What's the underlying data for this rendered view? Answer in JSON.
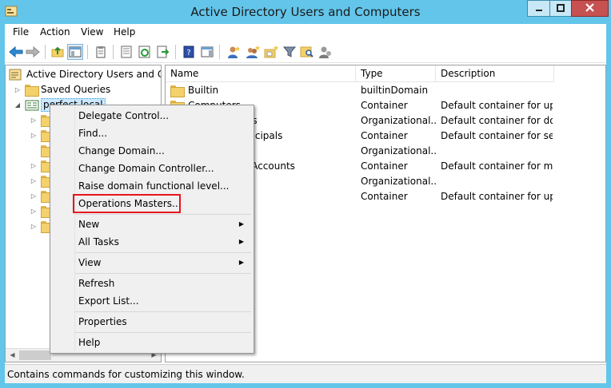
{
  "window": {
    "title": "Active Directory Users and Computers",
    "accent": "#63c5ea",
    "close_color": "#c75050"
  },
  "menubar": [
    "File",
    "Action",
    "View",
    "Help"
  ],
  "tree": {
    "root": "Active Directory Users and Com",
    "saved_queries": "Saved Queries",
    "domain": "perfect.local"
  },
  "list": {
    "columns": [
      "Name",
      "Type",
      "Description"
    ],
    "rows": [
      {
        "name": "Builtin",
        "type": "builtinDomain",
        "desc": ""
      },
      {
        "name": "Computers",
        "type": "Container",
        "desc": "Default container for up..."
      },
      {
        "name": "ers",
        "type": "Organizational...",
        "desc": "Default container for do..."
      },
      {
        "name": "rincipals",
        "type": "Container",
        "desc": "Default container for sec..."
      },
      {
        "name": "",
        "type": "Organizational...",
        "desc": ""
      },
      {
        "name": "e Accounts",
        "type": "Container",
        "desc": "Default container for ma..."
      },
      {
        "name": "",
        "type": "Organizational...",
        "desc": ""
      },
      {
        "name": "",
        "type": "Container",
        "desc": "Default container for up..."
      }
    ]
  },
  "context_menu": {
    "delegate": "Delegate Control...",
    "find": "Find...",
    "change_domain": "Change Domain...",
    "change_dc": "Change Domain Controller...",
    "raise": "Raise domain functional level...",
    "ops_masters": "Operations Masters...",
    "new": "New",
    "all_tasks": "All Tasks",
    "view": "View",
    "refresh": "Refresh",
    "export": "Export List...",
    "properties": "Properties",
    "help": "Help",
    "highlight_color": "#e8141d"
  },
  "status": "Contains commands for customizing this window."
}
